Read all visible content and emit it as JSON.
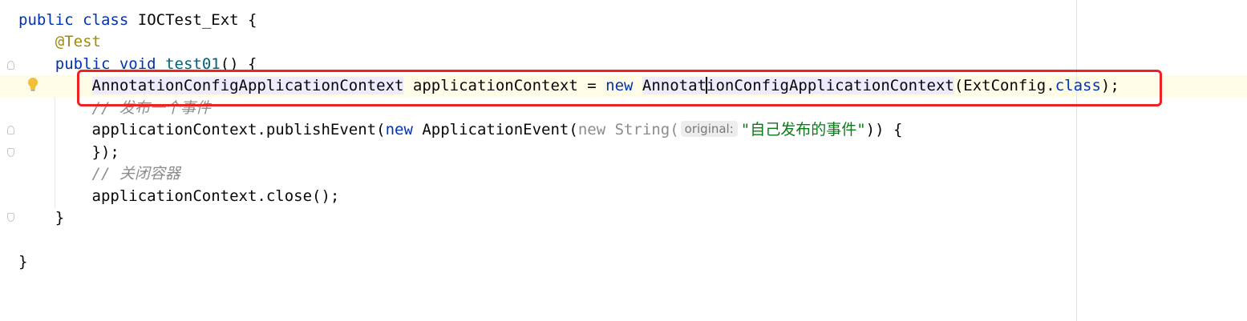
{
  "code": {
    "line1": {
      "kw1": "public",
      "kw2": "class",
      "class_name": "IOCTest_Ext",
      "brace": "{"
    },
    "line2": {
      "annotation": "@Test"
    },
    "line3": {
      "kw1": "public",
      "kw2": "void",
      "method": "test01",
      "rest": "() {"
    },
    "line4": {
      "type": "AnnotationConfigApplicationContext",
      "var_assign": "applicationContext =",
      "kw_new": "new",
      "ctor_a": "Annotat",
      "ctor_b": "ionConfigApplicationContext",
      "arg_open": "(ExtConfig.",
      "kw_class": "class",
      "end": ");"
    },
    "line5": {
      "comment": "// 发布一个事件"
    },
    "line6": {
      "call": "applicationContext.publishEvent(",
      "kw_new": "new",
      "event": "ApplicationEvent(",
      "gray_new_string": "new String(",
      "hint": "original:",
      "string": "\"自己发布的事件\"",
      "end": ")) {"
    },
    "line7": {
      "text": "});"
    },
    "line8": {
      "comment": "// 关闭容器"
    },
    "line9": {
      "text": "applicationContext.close();"
    },
    "line10": {
      "text": "}"
    },
    "line12": {
      "text": "}"
    }
  },
  "icons": {
    "intention": "lightbulb-icon",
    "fold": "fold-marker-icon"
  },
  "colors": {
    "keyword": "#0033b3",
    "annotation": "#9e880d",
    "string": "#067d17",
    "comment": "#8c8c8c",
    "caret_row": "#fefbe6",
    "highlight_border": "#ee2222"
  }
}
